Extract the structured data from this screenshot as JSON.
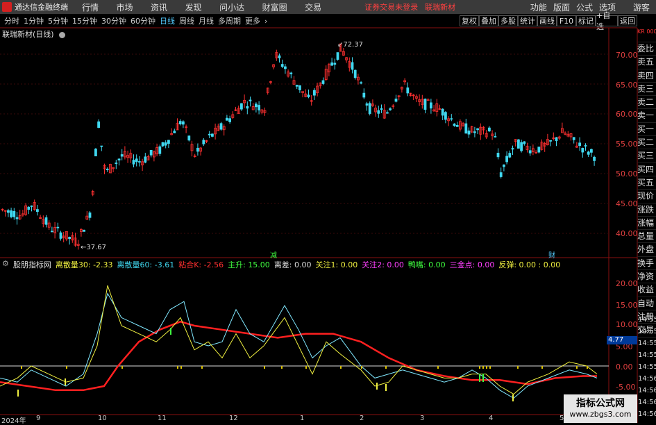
{
  "titlebar": {
    "app_title": "通达信金融终端",
    "menu": [
      "行情",
      "市场",
      "资讯",
      "发现",
      "问小达",
      "财富圈",
      "交易"
    ],
    "alert": "证券交易未登录",
    "alert_stock": "联瑞新材",
    "right_menu": [
      "功能",
      "版面",
      "公式",
      "选项"
    ],
    "guest": "游客"
  },
  "periods": [
    "分时",
    "1分钟",
    "5分钟",
    "15分钟",
    "30分钟",
    "60分钟",
    "日线",
    "周线",
    "月线",
    "多周期",
    "更多"
  ],
  "active_period": "日线",
  "toolbar_buttons": [
    "复权",
    "叠加",
    "多股",
    "统计",
    "画线",
    "F10",
    "标记",
    "+自选",
    "返回"
  ],
  "stock_title": "联瑞新材(日线)",
  "price_axis": [
    "70.00",
    "65.00",
    "60.00",
    "55.00",
    "50.00",
    "45.00",
    "40.00"
  ],
  "price_annotations": {
    "high": "72.37",
    "low": "37.67",
    "mark1": "减",
    "mark2": "财"
  },
  "indicator_bar": [
    {
      "label": "股朋指标网",
      "color": "#dddddd"
    },
    {
      "label": "离散量30: -2.33",
      "color": "#f0f040"
    },
    {
      "label": "离散量60: -3.61",
      "color": "#40d8f0"
    },
    {
      "label": "粘合K: -2.56",
      "color": "#ff3030"
    },
    {
      "label": "主升: 15.00",
      "color": "#40ff40"
    },
    {
      "label": "离差: 0.00",
      "color": "#dddddd"
    },
    {
      "label": "关注1: 0.00",
      "color": "#f0f040"
    },
    {
      "label": "关注2: 0.00",
      "color": "#ff40ff"
    },
    {
      "label": "鸭嘴: 0.00",
      "color": "#40ff40"
    },
    {
      "label": "三金点: 0.00",
      "color": "#ff40ff"
    },
    {
      "label": "反弹: 0.00 : 0.00",
      "color": "#f0f040"
    }
  ],
  "indicator_axis": [
    "20.00",
    "15.00",
    "10.00",
    "5.00",
    "0.00",
    "-5.00"
  ],
  "indicator_value_box": "4.77",
  "right_panel": [
    "委比",
    "卖五",
    "卖四",
    "卖三",
    "卖二",
    "卖一",
    "买一",
    "买二",
    "买三",
    "买四",
    "买五",
    "现价",
    "涨跌",
    "涨幅",
    "总量",
    "外盘",
    "换手",
    "净资",
    "收益",
    "自动",
    "注册",
    "交易"
  ],
  "right_panel_top": "KR 000",
  "time_labels": [
    "14:55",
    "14:55",
    "14:55",
    "14:55",
    "14:55",
    "14:56",
    "14:56",
    "14:56",
    "14:56"
  ],
  "date_axis": [
    "2024年",
    "9",
    "10",
    "11",
    "12",
    "1",
    "2",
    "3",
    "4",
    "5"
  ],
  "watermark": {
    "line1": "指标公式网",
    "line2": "www.zbgs3.com"
  },
  "colors": {
    "up": "#ff3030",
    "down": "#40d8f0",
    "ma": "#ff2020",
    "line_yellow": "#f0f040",
    "line_cyan": "#80e8ff"
  }
}
